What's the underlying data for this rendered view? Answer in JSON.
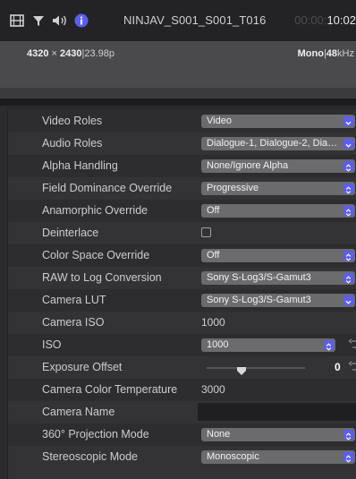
{
  "titlebar": {
    "clip_name": "NINJAV_S001_S001_T016",
    "timecode_dim": "00:00:",
    "timecode": "10:02"
  },
  "info": {
    "resolution_w": "4320",
    "resolution_x": " × ",
    "resolution_h": "2430",
    "fps": "|23.98p",
    "audio_channels": "Mono",
    "audio_sep": "|",
    "audio_rate": "48",
    "audio_unit": "kHz"
  },
  "rows": [
    {
      "label": "Video Roles",
      "value": "Video"
    },
    {
      "label": "Audio Roles",
      "value": "Dialogue-1, Dialogue-2, Dia…"
    },
    {
      "label": "Alpha Handling",
      "value": "None/Ignore Alpha"
    },
    {
      "label": "Field Dominance Override",
      "value": "Progressive"
    },
    {
      "label": "Anamorphic Override",
      "value": "Off"
    },
    {
      "label": "Deinterlace",
      "value": ""
    },
    {
      "label": "Color Space Override",
      "value": "Off"
    },
    {
      "label": "RAW to Log Conversion",
      "value": "Sony S-Log3/S-Gamut3"
    },
    {
      "label": "Camera LUT",
      "value": "Sony S-Log3/S-Gamut3"
    },
    {
      "label": "Camera ISO",
      "value": "1000"
    },
    {
      "label": "ISO",
      "value": "1000"
    },
    {
      "label": "Exposure Offset",
      "value": "0"
    },
    {
      "label": "Camera Color Temperature",
      "value": "3000"
    },
    {
      "label": "Camera Name",
      "value": ""
    },
    {
      "label": "360° Projection Mode",
      "value": "None"
    },
    {
      "label": "Stereoscopic Mode",
      "value": "Monoscopic"
    }
  ],
  "exposure_offset_fraction": 0.35,
  "colors": {
    "accent": "#5b5ef0",
    "popup": "#6b6b6e",
    "panel": "#333335"
  },
  "icons": [
    "filmstrip-icon",
    "filter-icon",
    "speaker-icon",
    "info-icon",
    "popup-chevron-icon",
    "popup-stepper-icon",
    "reset-arrow-icon",
    "slider-thumb-icon"
  ]
}
